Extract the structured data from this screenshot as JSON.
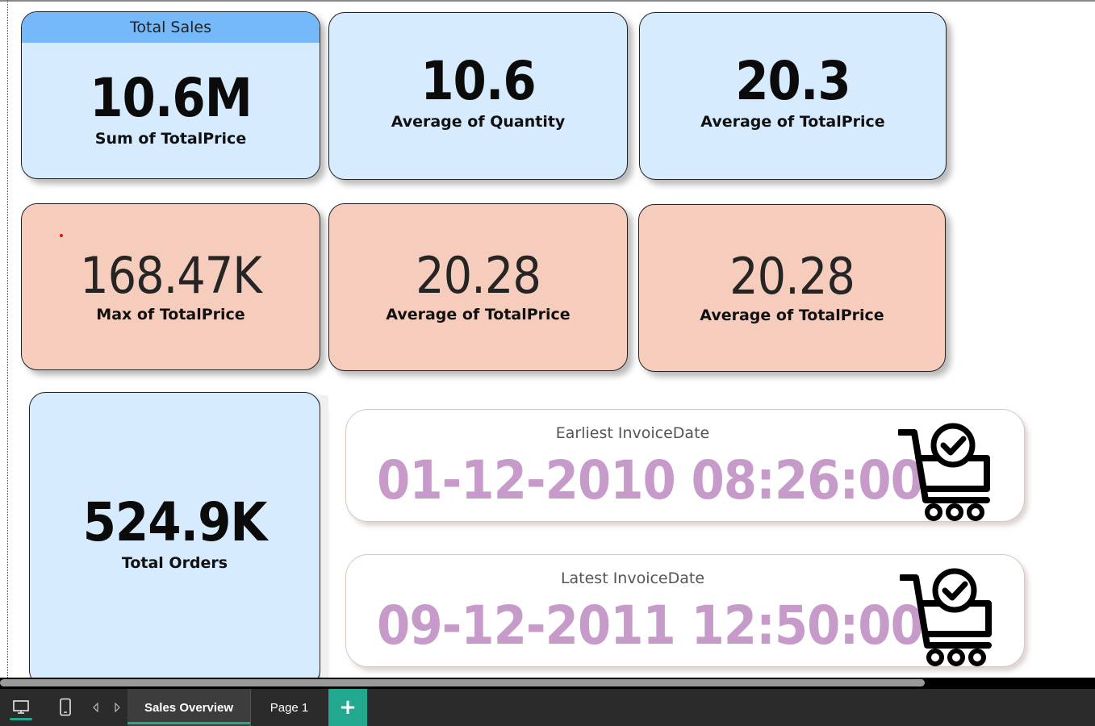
{
  "cards": {
    "total_sales": {
      "header": "Total Sales",
      "value": "10.6M",
      "label": "Sum of TotalPrice",
      "color": "#d6ebfd",
      "header_color": "#75b9fb"
    },
    "avg_quantity": {
      "value": "10.6",
      "label": "Average of Quantity"
    },
    "avg_totalprice_1": {
      "value": "20.3",
      "label": "Average of TotalPrice"
    },
    "max_totalprice": {
      "value": "168.47K",
      "label": "Max of TotalPrice",
      "color": "#f6cdbd"
    },
    "avg_totalprice_2": {
      "value": "20.28",
      "label": "Average of TotalPrice"
    },
    "avg_totalprice_3": {
      "value": "20.28",
      "label": "Average of TotalPrice"
    },
    "total_orders": {
      "value": "524.9K",
      "label": "Total Orders"
    }
  },
  "dates": {
    "earliest": {
      "label": "Earliest InvoiceDate",
      "value": "01-12-2010 08:26:00",
      "icon": "shopping-cart-check-icon"
    },
    "latest": {
      "label": "Latest InvoiceDate",
      "value": "09-12-2011 12:50:00",
      "icon": "shopping-cart-check-icon"
    },
    "value_color": "#c69bca"
  },
  "tabbar": {
    "desktop_icon": "desktop-layout-icon",
    "mobile_icon": "mobile-layout-icon",
    "tabs": [
      {
        "label": "Sales Overview",
        "active": true
      },
      {
        "label": "Page 1",
        "active": false
      }
    ],
    "add_label": "+",
    "accent": "#21a88f"
  }
}
